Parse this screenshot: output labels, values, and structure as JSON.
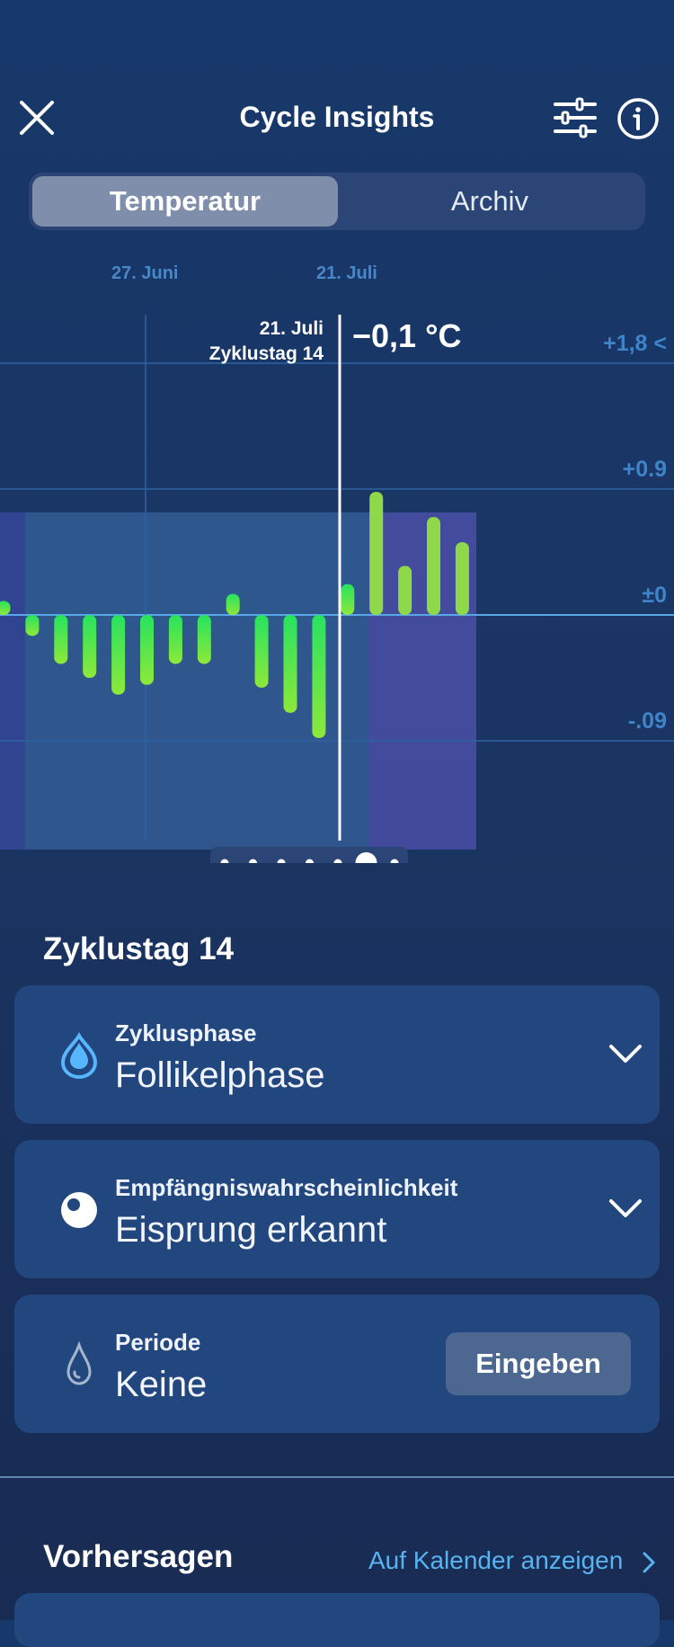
{
  "header": {
    "title": "Cycle Insights",
    "close_icon": "close-icon",
    "filter_icon": "sliders-icon",
    "info_icon": "info-icon"
  },
  "tabs": [
    {
      "label": "Temperatur",
      "active": true
    },
    {
      "label": "Archiv",
      "active": false
    }
  ],
  "chart_data": {
    "type": "bar",
    "x_date_labels": [
      "27. Juni",
      "21. Juli"
    ],
    "y_tick_labels": [
      "+1,8 <",
      "+0.9",
      "±0",
      "-.09"
    ],
    "y_ticks": [
      1.8,
      0.9,
      0,
      -0.9
    ],
    "ylim": [
      -1.6,
      2.0
    ],
    "values": [
      0.1,
      -0.15,
      -0.35,
      -0.45,
      -0.57,
      -0.5,
      -0.35,
      -0.35,
      0.15,
      -0.52,
      -0.7,
      -0.88,
      0.22,
      0.88,
      0.35,
      0.7,
      0.52
    ],
    "selected": {
      "date": "21. Juli",
      "cycle_day": "Zyklustag 14",
      "value_text": "−0,1 °C"
    },
    "colors": {
      "low": "#40e070",
      "high": "#8fd84a",
      "grid": "#2f62a2",
      "zero": "#58a8e8",
      "cursor": "#ffffff"
    },
    "page_dots": 7,
    "active_page": 6
  },
  "day": {
    "title": "Zyklustag 14",
    "cards": [
      {
        "label": "Zyklusphase",
        "value": "Follikelphase",
        "icon": "droplet-icon",
        "action": "chevron-down-icon"
      },
      {
        "label": "Empfängniswahrscheinlichkeit",
        "value": "Eisprung erkannt",
        "icon": "ovulation-icon",
        "action": "chevron-down-icon"
      },
      {
        "label": "Periode",
        "value": "Keine",
        "icon": "droplet-outline-icon",
        "button": "Eingeben"
      }
    ]
  },
  "predictions": {
    "title": "Vorhersagen",
    "link": "Auf Kalender anzeigen"
  }
}
